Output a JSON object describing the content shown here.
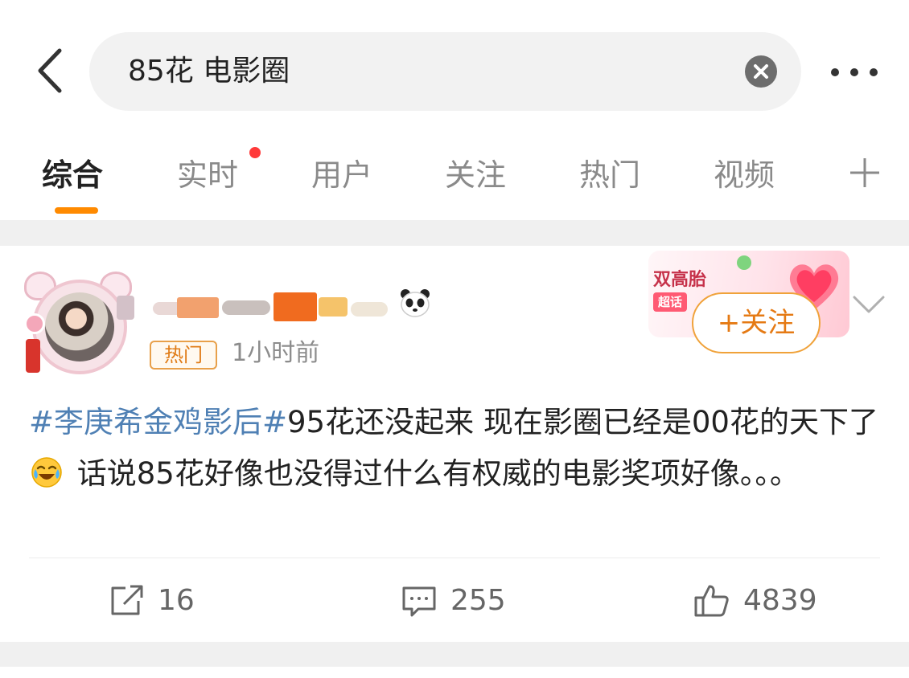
{
  "search": {
    "query": "85花 电影圈"
  },
  "tabs": [
    {
      "label": "综合",
      "active": true
    },
    {
      "label": "实时",
      "has_dot": true
    },
    {
      "label": "用户"
    },
    {
      "label": "关注"
    },
    {
      "label": "热门"
    },
    {
      "label": "视频"
    }
  ],
  "post": {
    "hot_badge": "热门",
    "time": "1小时前",
    "follow_label": "+关注",
    "promo": {
      "title": "双高胎",
      "tag": "超话"
    },
    "topic": "#李庚希金鸡影后#",
    "text_part1": "95花还没起来 现在影圈已经是00花的天下了",
    "text_part2": " 话说85花好像也没得过什么有权威的电影奖项好像。。。",
    "actions": {
      "repost_count": "16",
      "comment_count": "255",
      "like_count": "4839"
    }
  },
  "colors": {
    "accent": "#ff8a00",
    "follow": "#e57a14",
    "topic_link": "#4f80b4",
    "red_dot": "#ff3a3a"
  },
  "icons": [
    "back-arrow-icon",
    "clear-icon",
    "more-icon",
    "plus-icon",
    "panda-icon",
    "chevron-down-icon",
    "laugh-cry-emoji",
    "repost-icon",
    "comment-icon",
    "like-icon"
  ]
}
